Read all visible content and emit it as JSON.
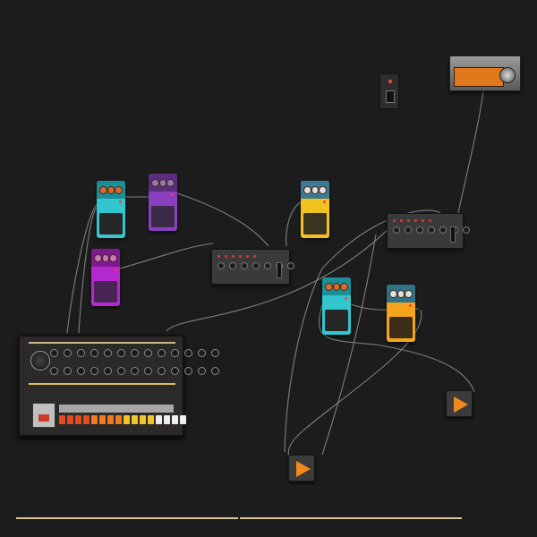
{
  "workspace": {
    "background": "#1c1c1c",
    "cable_color": "#8a8a8a",
    "accent": "#f08a1e"
  },
  "nodes": {
    "drum_machine": {
      "icon": "drum-machine"
    },
    "pedals": [
      {
        "id": "pedal-cyan-1",
        "color": "#33c6cf"
      },
      {
        "id": "pedal-purple-1",
        "color": "#8a3fbf"
      },
      {
        "id": "pedal-magenta-1",
        "color": "#b428cf"
      },
      {
        "id": "pedal-yellow-1",
        "color": "#f1c21d"
      },
      {
        "id": "pedal-cyan-2",
        "color": "#33c6cf"
      },
      {
        "id": "pedal-orange-1",
        "color": "#f5a51b"
      }
    ],
    "mixers": [
      {
        "id": "mixer-1"
      },
      {
        "id": "mixer-2"
      }
    ],
    "switch": {
      "icon": "switch-icon"
    },
    "meter": {
      "icon": "vu-meter-icon"
    },
    "outputs": [
      {
        "id": "output-1",
        "icon": "play-icon"
      },
      {
        "id": "output-2",
        "icon": "play-icon"
      }
    ]
  },
  "timeline": {
    "color": "#d8c59a",
    "segments": 2
  }
}
